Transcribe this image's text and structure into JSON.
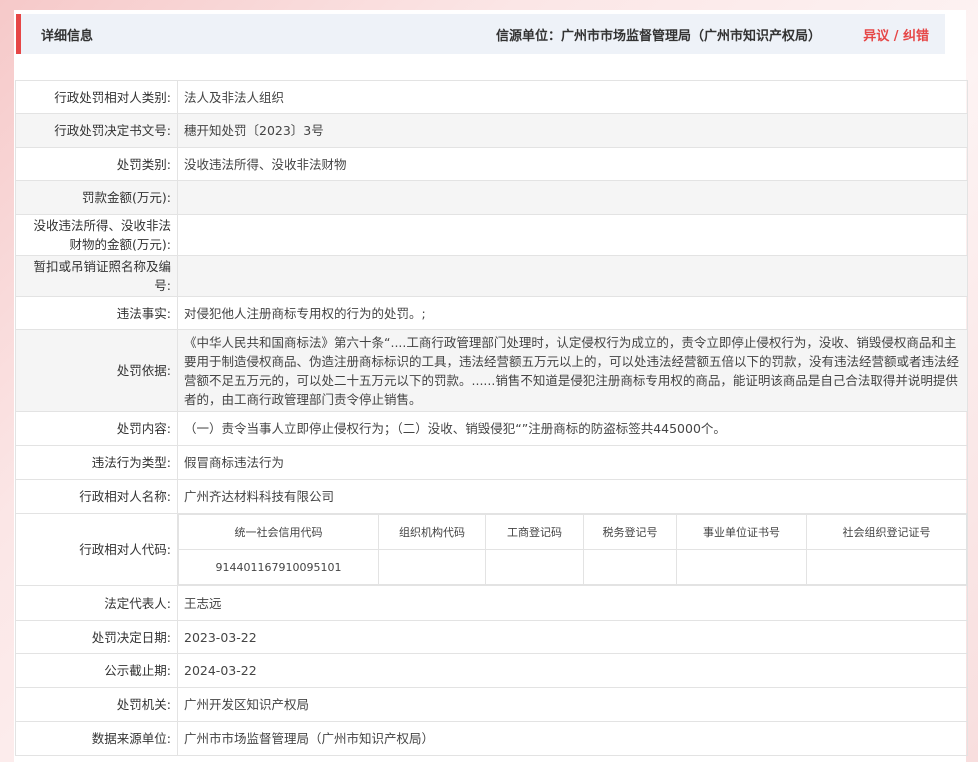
{
  "header": {
    "title": "详细信息",
    "source": "信源单位：广州市市场监督管理局（广州市知识产权局）",
    "feedback": "异议 / 纠错"
  },
  "rows": {
    "party_type": {
      "label": "行政处罚相对人类别:",
      "value": "法人及非法人组织"
    },
    "decision_no": {
      "label": "行政处罚决定书文号:",
      "value": "穗开知处罚〔2023〕3号"
    },
    "penalty_type": {
      "label": "处罚类别:",
      "value": "没收违法所得、没收非法财物"
    },
    "fine": {
      "label": "罚款金额(万元):",
      "value": ""
    },
    "confiscation": {
      "label": "没收违法所得、没收非法财物的金额(万元):",
      "value": ""
    },
    "license": {
      "label": "暂扣或吊销证照名称及编号:",
      "value": ""
    },
    "facts": {
      "label": "违法事实:",
      "value": "对侵犯他人注册商标专用权的行为的处罚。;"
    },
    "basis": {
      "label": "处罚依据:",
      "value": "《中华人民共和国商标法》第六十条“....工商行政管理部门处理时，认定侵权行为成立的，责令立即停止侵权行为，没收、销毁侵权商品和主要用于制造侵权商品、伪造注册商标标识的工具，违法经营额五万元以上的，可以处违法经营额五倍以下的罚款，没有违法经营额或者违法经营额不足五万元的，可以处二十五万元以下的罚款。......销售不知道是侵犯注册商标专用权的商品，能证明该商品是自己合法取得并说明提供者的，由工商行政管理部门责令停止销售。"
    },
    "content": {
      "label": "处罚内容:",
      "value": "（一）责令当事人立即停止侵权行为；（二）没收、销毁侵犯“”注册商标的防盗标签共445000个。"
    },
    "violation_type": {
      "label": "违法行为类型:",
      "value": "假冒商标违法行为"
    },
    "party_name": {
      "label": "行政相对人名称:",
      "value": "广州齐达材料科技有限公司"
    },
    "party_code": {
      "label": "行政相对人代码:"
    },
    "legal_rep": {
      "label": "法定代表人:",
      "value": "王志远"
    },
    "decision_date": {
      "label": "处罚决定日期:",
      "value": "2023-03-22"
    },
    "publish_end": {
      "label": "公示截止期:",
      "value": "2024-03-22"
    },
    "authority": {
      "label": "处罚机关:",
      "value": "广州开发区知识产权局"
    },
    "data_source": {
      "label": "数据来源单位:",
      "value": "广州市市场监督管理局（广州市知识产权局）"
    }
  },
  "codes": {
    "headers": [
      "统一社会信用代码",
      "组织机构代码",
      "工商登记码",
      "税务登记号",
      "事业单位证书号",
      "社会组织登记证号"
    ],
    "values": [
      "914401167910095101",
      "",
      "",
      "",
      "",
      ""
    ]
  }
}
